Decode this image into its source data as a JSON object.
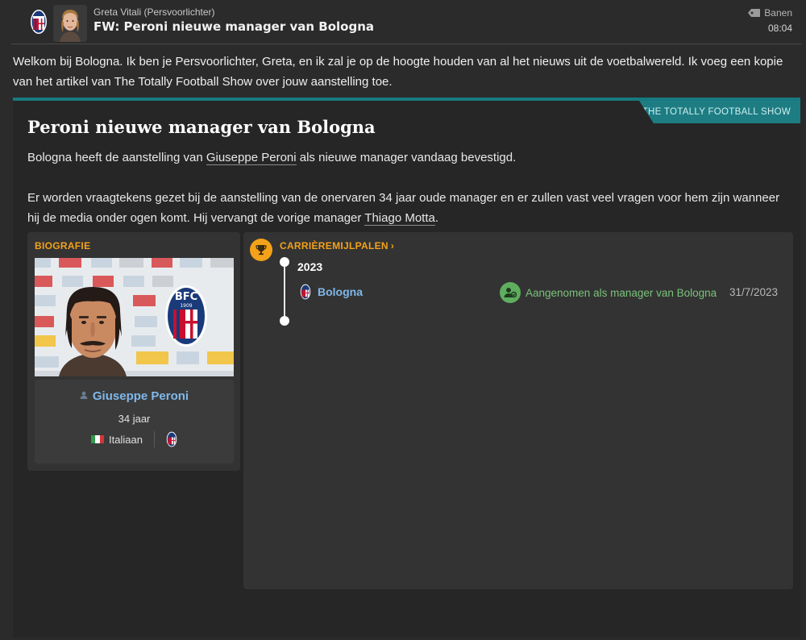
{
  "header": {
    "sender": "Greta Vitali  (Persvoorlichter)",
    "subject": "FW: Peroni nieuwe manager van Bologna",
    "tag_label": "Banen",
    "time": "08:04"
  },
  "intro": "Welkom bij Bologna. Ik ben je Persvoorlichter, Greta, en ik zal je op de hoogte houden van al het nieuws uit de voetbalwereld. Ik voeg een kopie van het artikel van The Totally Football Show over jouw aanstelling toe.",
  "article": {
    "source": "THE TOTALLY FOOTBALL SHOW",
    "title": "Peroni nieuwe manager van Bologna",
    "p1_before": "Bologna heeft de aanstelling van ",
    "p1_link": "Giuseppe Peroni",
    "p1_after": " als nieuwe manager vandaag bevestigd.",
    "p2_before": "Er worden vraagtekens gezet bij de aanstelling van de onervaren 34 jaar oude manager en er zullen vast veel vragen voor hem zijn wanneer hij de media onder ogen komt. Hij vervangt de vorige manager ",
    "p2_link": "Thiago Motta",
    "p2_after": "."
  },
  "bio": {
    "label": "BIOGRAFIE",
    "name": "Giuseppe Peroni",
    "age": "34 jaar",
    "nationality": "Italiaan",
    "badge_text": "BFC",
    "badge_year": "1909"
  },
  "milestones": {
    "label": "CARRIÈREMIJLPALEN",
    "chevron": "›",
    "items": [
      {
        "year": "2023",
        "club": "Bologna",
        "event": "Aangenomen als manager van Bologna",
        "date": "31/7/2023"
      }
    ]
  },
  "colors": {
    "accent": "#f4a21a",
    "teal": "#1d7d83",
    "link": "#7fb8ea",
    "green": "#7ac27a",
    "background": "#2b2b2b"
  }
}
